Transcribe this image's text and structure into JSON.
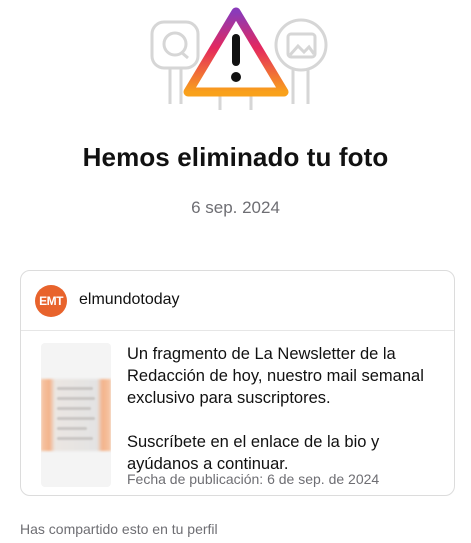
{
  "notice": {
    "title": "Hemos eliminado tu foto",
    "date": "6 sep. 2024"
  },
  "icons": {
    "hero": [
      "chat-bubble-icon",
      "warning-triangle-icon",
      "photo-icon"
    ]
  },
  "colors": {
    "gradient_start": "#f9a11b",
    "gradient_mid": "#e4285e",
    "gradient_end": "#8a3ab9",
    "avatar": "#e8632c",
    "secondary_text": "#6e6e73"
  },
  "post": {
    "avatar_text": "EMT",
    "username": "elmundotoday",
    "caption_p1": "Un fragmento de La Newsletter de la Redacción de hoy, nuestro mail semanal exclusivo para suscriptores.",
    "caption_p2": "Suscríbete en el enlace de la bio y ayúdanos a continuar.",
    "published": "Fecha de publicación: 6 de sep. de 2024"
  },
  "footer": {
    "note": "Has compartido esto en tu perfil"
  }
}
